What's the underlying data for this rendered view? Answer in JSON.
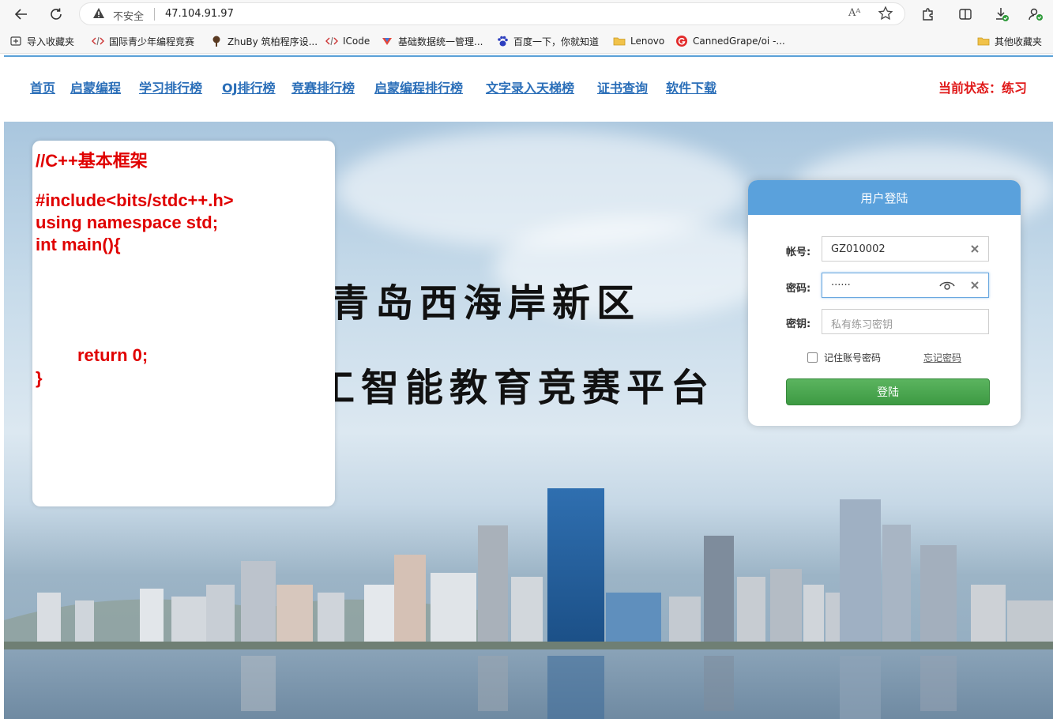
{
  "browser": {
    "security_label": "不安全",
    "url": "47.104.91.97",
    "read_aloud_label": "Aᴬ",
    "bookmarks": [
      {
        "label": "导入收藏夹",
        "icon": "import-icon"
      },
      {
        "label": "国际青少年编程竞赛",
        "icon": "code-icon"
      },
      {
        "label": "ZhuBy 筑柏程序设...",
        "icon": "tree-icon"
      },
      {
        "label": "ICode",
        "icon": "code-icon"
      },
      {
        "label": "基础数据统一管理...",
        "icon": "colorful-logo-icon"
      },
      {
        "label": "百度一下，你就知道",
        "icon": "baidu-icon"
      },
      {
        "label": "Lenovo",
        "icon": "folder-icon"
      },
      {
        "label": "CannedGrape/oi -...",
        "icon": "g-logo-icon"
      },
      {
        "label": "其他收藏夹",
        "icon": "folder-icon"
      }
    ]
  },
  "nav": {
    "links": [
      "首页",
      "启蒙编程",
      "学习排行榜",
      "OJ排行榜",
      "竞赛排行榜",
      "启蒙编程排行榜",
      "文字录入天梯榜",
      "证书查询",
      "软件下载"
    ],
    "status": "当前状态：练习"
  },
  "hero": {
    "title_line1": "青岛西海岸新区",
    "title_line2": "工智能教育竞赛平台"
  },
  "code_card": {
    "lines": [
      "//C++基本框架",
      "#include<bits/stdc++.h>",
      "using namespace std;",
      "int main(){",
      "return 0;",
      "}"
    ]
  },
  "login": {
    "title": "用户登陆",
    "account_label": "帐号:",
    "account_value": "GZ010002",
    "password_label": "密码:",
    "password_value": "······",
    "key_label": "密钥:",
    "key_placeholder": "私有练习密钥",
    "remember_label": "记住账号密码",
    "forgot_label": "忘记密码",
    "submit_label": "登陆"
  },
  "colors": {
    "nav_link": "#2a6eb8",
    "status": "#e01818",
    "code_text": "#e00000",
    "login_header": "#5aa1dc",
    "login_button": "#3d9a43"
  }
}
